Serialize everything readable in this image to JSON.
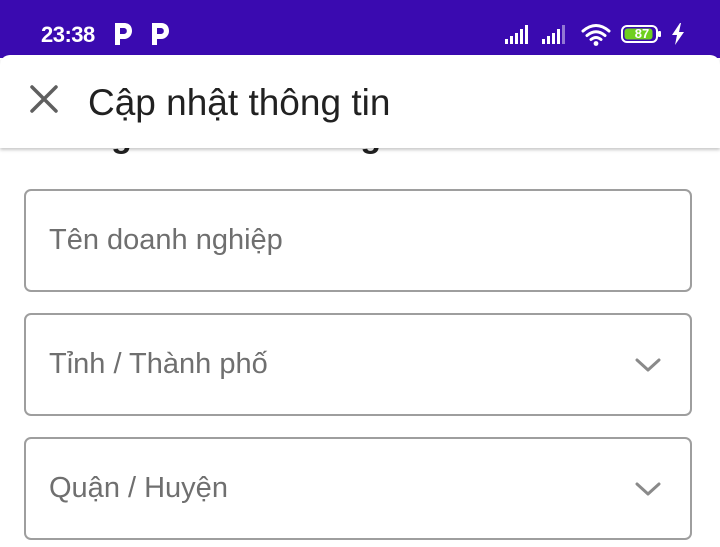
{
  "status_bar": {
    "time": "23:38",
    "notification_icons": [
      "parking-p-icon",
      "parking-p-icon"
    ],
    "battery_level": "87",
    "background_color": "#3a0ab0"
  },
  "app_bar": {
    "title": "Cập nhật thông tin",
    "close_icon": "close-icon"
  },
  "section": {
    "title": "Thông tin khách hàng"
  },
  "form": {
    "business_name": {
      "placeholder": "Tên doanh nghiệp"
    },
    "province": {
      "placeholder": "Tỉnh / Thành phố",
      "icon": "chevron-down-icon"
    },
    "district": {
      "placeholder": "Quận / Huyện",
      "icon": "chevron-down-icon"
    }
  },
  "colors": {
    "field_border": "#9e9e9e",
    "placeholder_text": "#6f6f6f",
    "title_text": "#212121"
  }
}
